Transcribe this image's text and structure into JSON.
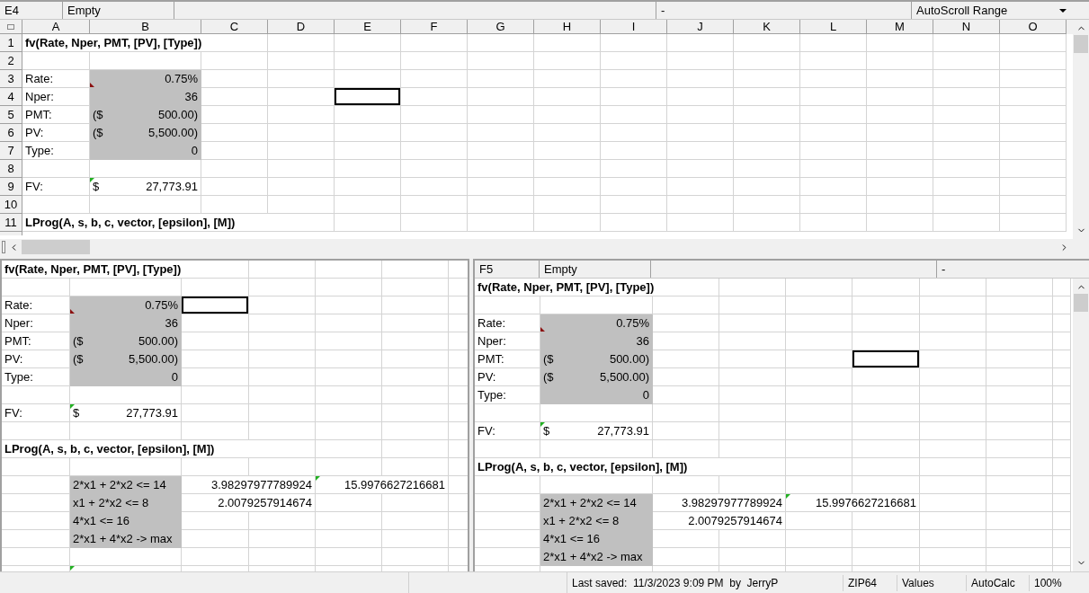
{
  "top_pane": {
    "name_box": "E4",
    "cell_content": "Empty",
    "field_3": "-",
    "dropdown": "AutoScroll Range",
    "columns": [
      "A",
      "B",
      "C",
      "D",
      "E",
      "F",
      "G",
      "H",
      "I",
      "J",
      "K",
      "L",
      "M",
      "N",
      "O"
    ],
    "rows": [
      {
        "number": "1",
        "cells": [
          {
            "text": "fv(Rate, Nper, PMT, [PV], [Type])",
            "kind": "label",
            "bold": true,
            "selected": false
          }
        ]
      },
      {
        "number": "2",
        "cells": []
      },
      {
        "number": "3",
        "cells": [
          {
            "text": "Rate:",
            "kind": "label",
            "selected": false
          },
          {
            "text": "0.75%",
            "kind": "number",
            "shaded": true,
            "flag": {
              "kind": "bottom",
              "color": "#8b1010"
            },
            "selected": false
          }
        ]
      },
      {
        "number": "4",
        "cells": [
          {
            "text": "Nper:",
            "kind": "label",
            "selected": false
          },
          {
            "text": "36",
            "kind": "number",
            "shaded": true,
            "selected": false
          },
          {
            "selected": false
          },
          {
            "selected": false
          },
          {
            "selected": true
          }
        ]
      },
      {
        "number": "5",
        "cells": [
          {
            "text": "PMT:",
            "kind": "label",
            "selected": false
          },
          {
            "prefix": "($",
            "text": "500.00)",
            "kind": "number",
            "shaded": true,
            "selected": false
          }
        ]
      },
      {
        "number": "6",
        "cells": [
          {
            "text": "PV:",
            "kind": "label",
            "selected": false
          },
          {
            "prefix": "($",
            "text": "5,500.00)",
            "kind": "number",
            "shaded": true,
            "selected": false
          }
        ]
      },
      {
        "number": "7",
        "cells": [
          {
            "text": "Type:",
            "kind": "label",
            "selected": false
          },
          {
            "text": "0",
            "kind": "number",
            "shaded": true,
            "selected": false
          }
        ]
      },
      {
        "number": "8",
        "cells": []
      },
      {
        "number": "9",
        "cells": [
          {
            "text": "FV:",
            "kind": "label",
            "selected": false
          },
          {
            "prefix": "$",
            "text": "27,773.91",
            "kind": "number",
            "flag": {
              "kind": "top",
              "color": "#22b022"
            },
            "selected": false
          }
        ]
      },
      {
        "number": "10",
        "cells": []
      },
      {
        "number": "11",
        "cells": [
          {
            "text": "LProg(A, s, b, c, vector, [epsilon], [M])",
            "kind": "label",
            "bold": true,
            "selected": false
          }
        ]
      }
    ]
  },
  "bottom_left_pane": {
    "rows": [
      {
        "cells": [
          {
            "text": "fv(Rate, Nper, PMT, [PV], [Type])",
            "kind": "label",
            "bold": true,
            "selected": false
          }
        ]
      },
      {
        "cells": []
      },
      {
        "cells": [
          {
            "text": "Rate:",
            "kind": "label",
            "selected": false
          },
          {
            "text": "0.75%",
            "kind": "number",
            "shaded": true,
            "flag": {
              "kind": "bottom",
              "color": "#8b1010"
            },
            "selected": false
          },
          {
            "selected": true
          }
        ]
      },
      {
        "cells": [
          {
            "text": "Nper:",
            "kind": "label",
            "selected": false
          },
          {
            "text": "36",
            "kind": "number",
            "shaded": true,
            "selected": false
          }
        ]
      },
      {
        "cells": [
          {
            "text": "PMT:",
            "kind": "label",
            "selected": false
          },
          {
            "prefix": "($",
            "text": "500.00)",
            "kind": "number",
            "shaded": true,
            "selected": false
          }
        ]
      },
      {
        "cells": [
          {
            "text": "PV:",
            "kind": "label",
            "selected": false
          },
          {
            "prefix": "($",
            "text": "5,500.00)",
            "kind": "number",
            "shaded": true,
            "selected": false
          }
        ]
      },
      {
        "cells": [
          {
            "text": "Type:",
            "kind": "label",
            "selected": false
          },
          {
            "text": "0",
            "kind": "number",
            "shaded": true,
            "selected": false
          }
        ]
      },
      {
        "cells": []
      },
      {
        "cells": [
          {
            "text": "FV:",
            "kind": "label",
            "selected": false
          },
          {
            "prefix": "$",
            "text": "27,773.91",
            "kind": "number",
            "flag": {
              "kind": "top",
              "color": "#22b022"
            },
            "selected": false
          }
        ]
      },
      {
        "cells": []
      },
      {
        "cells": [
          {
            "text": "LProg(A, s, b, c, vector, [epsilon], [M])",
            "kind": "label",
            "bold": true,
            "selected": false
          }
        ]
      },
      {
        "cells": []
      },
      {
        "cells": [
          {
            "selected": false
          },
          {
            "text": "2*x1 + 2*x2 <= 14",
            "kind": "label",
            "shaded": true,
            "selected": false
          },
          {
            "selected": false
          },
          {
            "text": "3.98297977789924",
            "kind": "number",
            "selected": false
          },
          {
            "flag": {
              "kind": "top",
              "color": "#22b022"
            },
            "selected": false
          },
          {
            "text": "15.9976627216681",
            "kind": "number",
            "selected": false
          }
        ]
      },
      {
        "cells": [
          {
            "selected": false
          },
          {
            "text": "x1 + 2*x2 <= 8",
            "kind": "label",
            "shaded": true,
            "selected": false
          },
          {
            "selected": false
          },
          {
            "text": "2.0079257914674",
            "kind": "number",
            "selected": false
          }
        ]
      },
      {
        "cells": [
          {
            "selected": false
          },
          {
            "text": "4*x1 <= 16",
            "kind": "label",
            "shaded": true,
            "selected": false
          }
        ]
      },
      {
        "cells": [
          {
            "selected": false
          },
          {
            "text": "2*x1 + 4*x2 -> max",
            "kind": "label",
            "shaded": true,
            "selected": false
          }
        ]
      },
      {
        "cells": []
      },
      {
        "cells": [
          {
            "selected": false
          },
          {
            "flag": {
              "kind": "top",
              "color": "#22b022"
            },
            "selected": false
          }
        ]
      }
    ]
  },
  "right_pane": {
    "name_box": "F5",
    "cell_content": "Empty",
    "field_3": "-",
    "rows": [
      {
        "cells": [
          {
            "text": "fv(Rate, Nper, PMT, [PV], [Type])",
            "kind": "label",
            "bold": true,
            "selected": false
          }
        ]
      },
      {
        "cells": []
      },
      {
        "cells": [
          {
            "text": "Rate:",
            "kind": "label",
            "selected": false
          },
          {
            "text": "0.75%",
            "kind": "number",
            "shaded": true,
            "flag": {
              "kind": "bottom",
              "color": "#8b1010"
            },
            "selected": false
          }
        ]
      },
      {
        "cells": [
          {
            "text": "Nper:",
            "kind": "label",
            "selected": false
          },
          {
            "text": "36",
            "kind": "number",
            "shaded": true,
            "selected": false
          }
        ]
      },
      {
        "cells": [
          {
            "text": "PMT:",
            "kind": "label",
            "selected": false
          },
          {
            "prefix": "($",
            "text": "500.00)",
            "kind": "number",
            "shaded": true,
            "selected": false
          },
          {
            "selected": false
          },
          {
            "selected": false
          },
          {
            "selected": false
          },
          {
            "selected": true
          }
        ]
      },
      {
        "cells": [
          {
            "text": "PV:",
            "kind": "label",
            "selected": false
          },
          {
            "prefix": "($",
            "text": "5,500.00)",
            "kind": "number",
            "shaded": true,
            "selected": false
          }
        ]
      },
      {
        "cells": [
          {
            "text": "Type:",
            "kind": "label",
            "selected": false
          },
          {
            "text": "0",
            "kind": "number",
            "shaded": true,
            "selected": false
          }
        ]
      },
      {
        "cells": []
      },
      {
        "cells": [
          {
            "text": "FV:",
            "kind": "label",
            "selected": false
          },
          {
            "prefix": "$",
            "text": "27,773.91",
            "kind": "number",
            "flag": {
              "kind": "top",
              "color": "#22b022"
            },
            "selected": false
          }
        ]
      },
      {
        "cells": []
      },
      {
        "cells": [
          {
            "text": "LProg(A, s, b, c, vector, [epsilon], [M])",
            "kind": "label",
            "bold": true,
            "selected": false
          }
        ]
      },
      {
        "cells": []
      },
      {
        "cells": [
          {
            "selected": false
          },
          {
            "text": "2*x1 + 2*x2 <= 14",
            "kind": "label",
            "shaded": true,
            "selected": false
          },
          {
            "selected": false
          },
          {
            "text": "3.98297977789924",
            "kind": "number",
            "selected": false
          },
          {
            "flag": {
              "kind": "top",
              "color": "#22b022"
            },
            "selected": false
          },
          {
            "text": "15.9976627216681",
            "kind": "number",
            "selected": false
          }
        ]
      },
      {
        "cells": [
          {
            "selected": false
          },
          {
            "text": "x1 + 2*x2 <= 8",
            "kind": "label",
            "shaded": true,
            "selected": false
          },
          {
            "selected": false
          },
          {
            "text": "2.0079257914674",
            "kind": "number",
            "selected": false
          }
        ]
      },
      {
        "cells": [
          {
            "selected": false
          },
          {
            "text": "4*x1 <= 16",
            "kind": "label",
            "shaded": true,
            "selected": false
          }
        ]
      },
      {
        "cells": [
          {
            "selected": false
          },
          {
            "text": "2*x1 + 4*x2 -> max",
            "kind": "label",
            "shaded": true,
            "selected": false
          }
        ]
      },
      {
        "cells": []
      }
    ]
  },
  "status_bar": {
    "last_saved": "Last saved:  11/3/2023 9:09 PM  by  JerryP",
    "format": "ZIP64",
    "display": "Values",
    "calc_mode": "AutoCalc",
    "zoom": "100%"
  }
}
